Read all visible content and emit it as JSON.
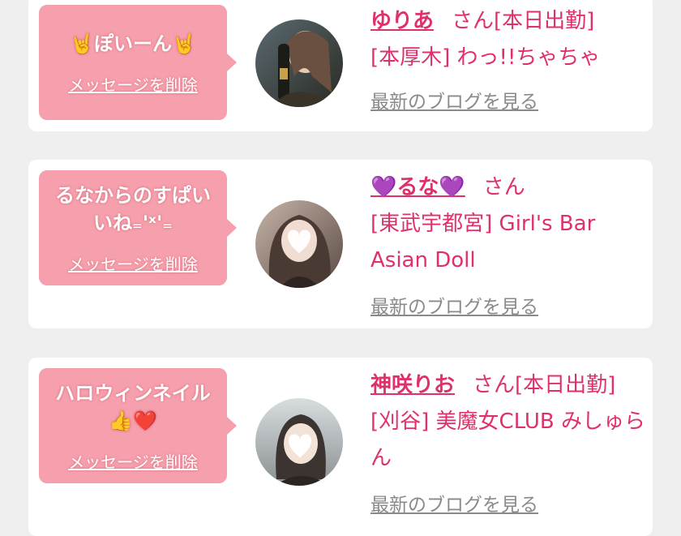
{
  "cards": [
    {
      "message": "🤘ぽいーん🤘",
      "delete_label": "メッセージを削除",
      "name": "ゆりあ",
      "san": "さん",
      "tag": "[本日出勤]",
      "shop": "[本厚木] わっ!!ちゃちゃ",
      "blog_label": "最新のブログを見る"
    },
    {
      "message": "るなからのすぱいいね₌'ˣ'₌",
      "delete_label": "メッセージを削除",
      "name": "💜るな💜",
      "san": "さん",
      "tag": "",
      "shop": "[東武宇都宮] Girl's Bar Asian Doll",
      "blog_label": "最新のブログを見る"
    },
    {
      "message": "ハロウィンネイル👍❤️",
      "delete_label": "メッセージを削除",
      "name": "神咲りお",
      "san": "さん",
      "tag": "[本日出勤]",
      "shop": "[刈谷] 美魔女CLUB みしゅらん",
      "blog_label": "最新のブログを見る"
    }
  ]
}
